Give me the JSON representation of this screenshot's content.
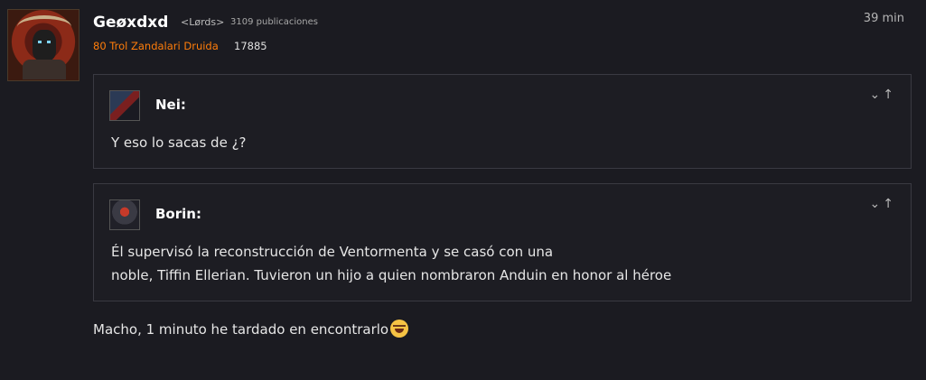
{
  "post": {
    "username": "Geøxdxd",
    "guild": "<Lørds>",
    "post_count": "3109 publicaciones",
    "class_line": "80 Trol Zandalari Druida",
    "achievement_points": "17885",
    "timestamp": "39 min"
  },
  "quotes": [
    {
      "author": "Nei:",
      "text_lines": [
        "Y eso lo sacas de ¿?"
      ]
    },
    {
      "author": "Borin:",
      "text_lines": [
        "Él supervisó la reconstrucción de Ventormenta y se casó con una",
        "noble, Tiffin Ellerian. Tuvieron un hijo a quien nombraron Anduin en honor al héroe"
      ]
    }
  ],
  "reply": {
    "text": "Macho, 1 minuto he tardado en encontrarlo"
  },
  "icons": {
    "expand": "chevron-down-icon",
    "go_to_post": "arrow-up-icon",
    "emoji": "tears-of-joy-emoji"
  }
}
